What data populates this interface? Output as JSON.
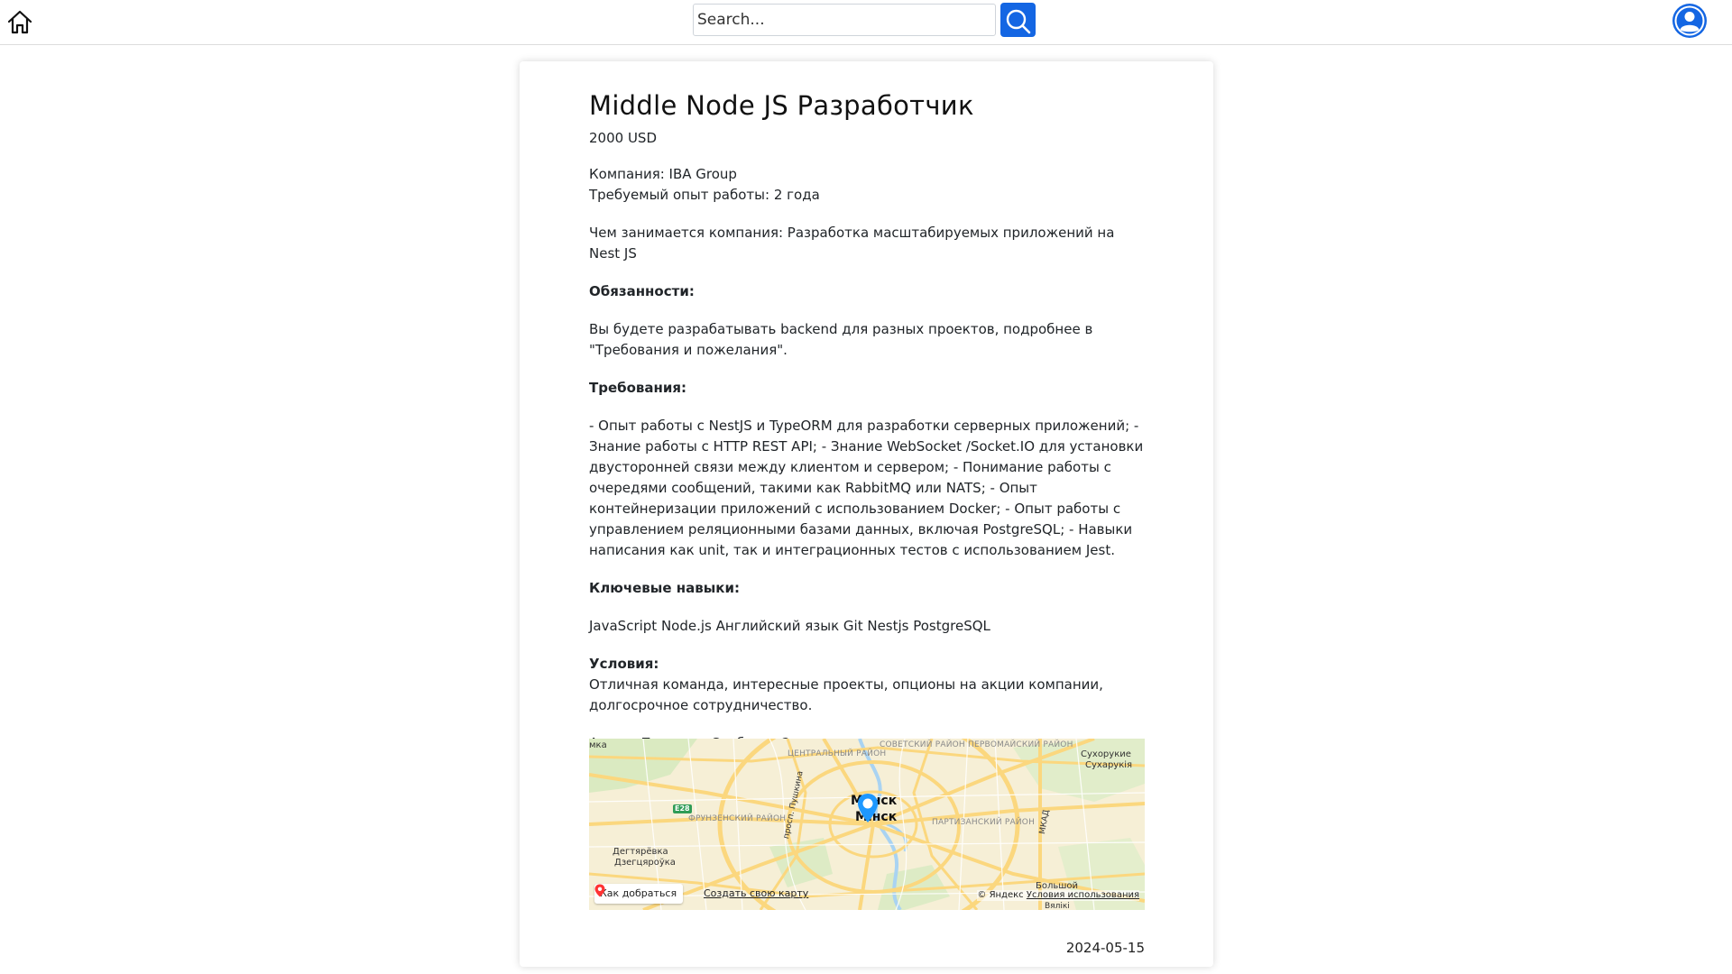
{
  "header": {
    "search_placeholder": "Search..."
  },
  "vacancy": {
    "title": "Middle Node JS Разработчик",
    "salary": "2000 USD",
    "company": "Компания: IBA Group",
    "experience": "Требуемый опыт работы: 2 года",
    "about": "Чем занимается компания: Разработка масштабируемых приложений на Nest JS",
    "duties_heading": "Обязанности:",
    "duties": "Вы будете разрабатывать backend для разных проектов, подробнее в \"Требования и пожелания\".",
    "requirements_heading": "Требования:",
    "requirements": "- Опыт работы с NestJS и TypeORM для разработки серверных приложений; - Знание работы с HTTP REST API; - Знание WebSocket /Socket.IO для установки двусторонней связи между клиентом и сервером; - Понимание работы с очередями сообщений, такими как RabbitMQ или NATS; - Опыт контейнеризации приложений с использованием Docker; - Опыт работы с управлением реляционными базами данных, включая PostgreSQL; - Навыки написания как unit, так и интеграционных тестов с использованием Jest.",
    "skills_heading": "Ключевые навыки:",
    "skills": "JavaScript Node.js Английский язык Git Nestjs PostgreSQL",
    "conditions_heading": "Условия:",
    "conditions": "Отличная команда, интересные проекты, опционы на акции компании, долгосрочное сотрудничество.",
    "address": "Адрес: Площадь Свободы, 2",
    "date": "2024-05-15"
  },
  "map": {
    "city_ru": "Минск",
    "city_by": "Мінск",
    "districts": {
      "sovetsky": "Советский район",
      "pervomaisky": "Первомайский район",
      "centralny": "Центральный район",
      "frunzensky": "Фрунзенский район",
      "partizansky": "Партизанский район"
    },
    "places": {
      "mka": "мка",
      "sukharuki": "Сухорукие",
      "sukharukia": "Сухарукія",
      "degtyarevka": "Дегтярёвка",
      "dzegtsyaroyka": "Дзегцяроўка",
      "bolshoy": "Большой",
      "vyaliki": "Вялікі",
      "pushkina": "просп. Пушкина",
      "mkad": "МКАД",
      "e28": "E28"
    },
    "route_label": "Как добраться",
    "create_map_label": "Создать свою карту",
    "copyright": "© Яндекс",
    "terms_label": "Условия использования"
  },
  "colors": {
    "accent": "#1466e3",
    "map_bg": "#f6efd6",
    "map_road": "#fbd77e",
    "map_water": "#a9d3f2",
    "map_park": "#cfe8b8"
  }
}
